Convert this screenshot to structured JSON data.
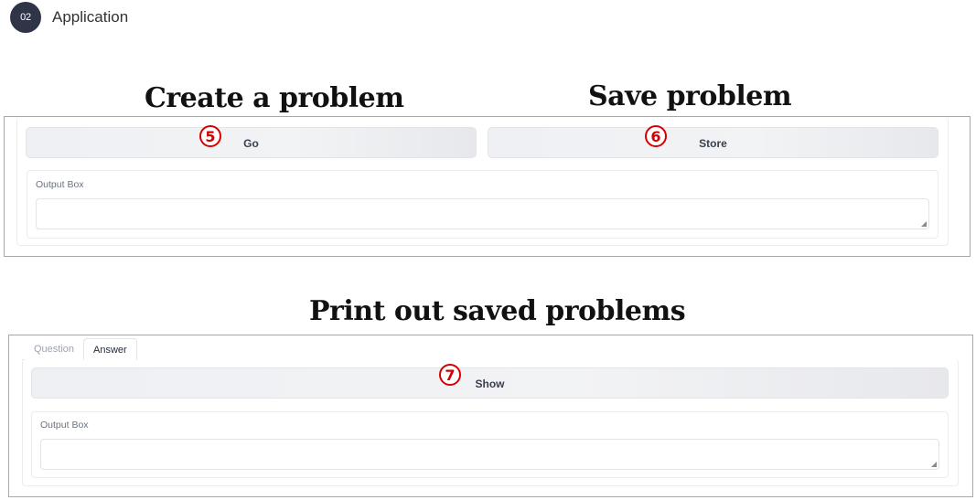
{
  "header": {
    "step_number": "02",
    "title": "Application"
  },
  "sections": {
    "create": {
      "heading": "Create a problem"
    },
    "save": {
      "heading": "Save problem"
    },
    "print": {
      "heading": "Print out saved problems"
    }
  },
  "top_panel": {
    "go_button": {
      "label": "Go",
      "marker": "5"
    },
    "store_button": {
      "label": "Store",
      "marker": "6"
    },
    "output": {
      "label": "Output Box",
      "value": ""
    }
  },
  "bottom_panel": {
    "tabs": [
      {
        "label": "Question",
        "active": false
      },
      {
        "label": "Answer",
        "active": true
      }
    ],
    "show_button": {
      "label": "Show",
      "marker": "7"
    },
    "output": {
      "label": "Output Box",
      "value": ""
    }
  },
  "colors": {
    "marker_red": "#d60000",
    "badge_bg": "#2f3447",
    "frame_border": "#a8a8a8"
  }
}
